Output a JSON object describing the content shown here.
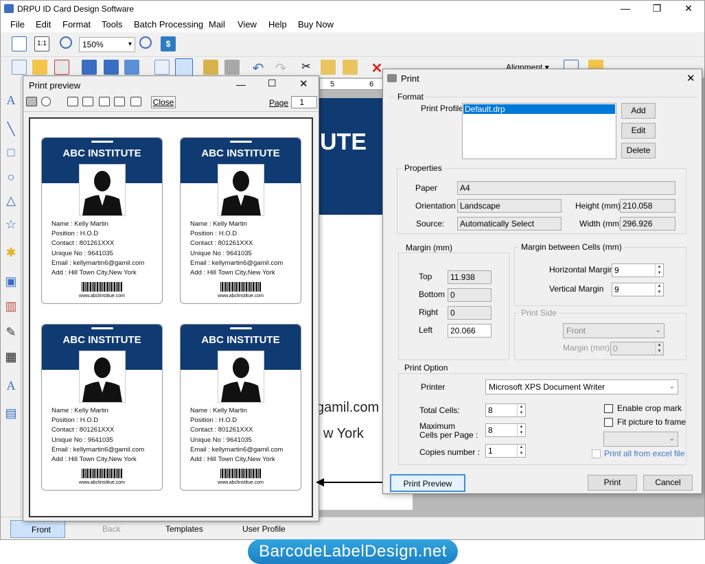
{
  "window": {
    "title": "DRPU ID Card Design Software",
    "minimize": "—",
    "maximize": "❐",
    "close": "✕"
  },
  "menu": [
    "File",
    "Edit",
    "Format",
    "Tools",
    "Batch Processing",
    "Mail",
    "View",
    "Help",
    "Buy Now"
  ],
  "toolbar": {
    "zoom": "150%",
    "alignment_label": "Alignment",
    "ruler_text": "5",
    "ruler_text2": "6"
  },
  "design": {
    "header_text": "UTE",
    "line1": "gamil.com",
    "line2": "w York"
  },
  "bottom_tabs": [
    "Front",
    "Back",
    "Templates",
    "User Profile"
  ],
  "print_preview": {
    "title": "Print preview",
    "close_label": "Close",
    "page_label": "Page",
    "page_value": "1"
  },
  "card": {
    "institute": "ABC INSTITUTE",
    "name": "Name : Kelly Martin",
    "position": "Position : H.O.D",
    "contact": "Contact : 801261XXX",
    "unique": "Unique No : 9641035",
    "email": "Email : kellymartin6@gamil.com",
    "address": "Add : Hill Town City,New York",
    "url": "www.abclinstitue.com"
  },
  "print_dialog": {
    "title": "Print",
    "format_label": "Format",
    "print_profile_label": "Print Profile",
    "profile_selected": "Default.drp",
    "add_button": "Add",
    "edit_button": "Edit",
    "delete_button": "Delete",
    "properties_label": "Properties",
    "paper_label": "Paper",
    "paper_value": "A4",
    "orientation_label": "Orientation",
    "orientation_value": "Landscape",
    "source_label": "Source:",
    "source_value": "Automatically Select",
    "height_label": "Height (mm)",
    "height_value": "210.058",
    "width_label": "Width (mm)",
    "width_value": "296.926",
    "margin_label": "Margin (mm)",
    "top_label": "Top",
    "top_value": "11.938",
    "bottom_label": "Bottom",
    "bottom_value": "0",
    "right_label": "Right",
    "right_value": "0",
    "left_label": "Left",
    "left_value": "20.066",
    "cell_margin_label": "Margin between Cells (mm)",
    "hmargin_label": "Horizontal Margin",
    "hmargin_value": "9",
    "vmargin_label": "Vertical Margin",
    "vmargin_value": "9",
    "print_side_label": "Print Side",
    "side_value": "Front",
    "side_margin_label": "Margin (mm)",
    "side_margin_value": "0",
    "print_option_label": "Print Option",
    "printer_label": "Printer",
    "printer_value": "Microsoft XPS Document Writer",
    "total_cells_label": "Total Cells:",
    "total_cells_value": "8",
    "max_cells_label1": "Maximum",
    "max_cells_label2": "Cells per Page :",
    "max_cells_value": "8",
    "copies_label": "Copies number :",
    "copies_value": "1",
    "crop_mark_label": "Enable crop mark",
    "fit_picture_label": "Fit picture to frame",
    "excel_label": "Print all from excel file",
    "print_preview_button": "Print Preview",
    "print_button": "Print",
    "cancel_button": "Cancel"
  },
  "brand": "BarcodeLabelDesign.net"
}
